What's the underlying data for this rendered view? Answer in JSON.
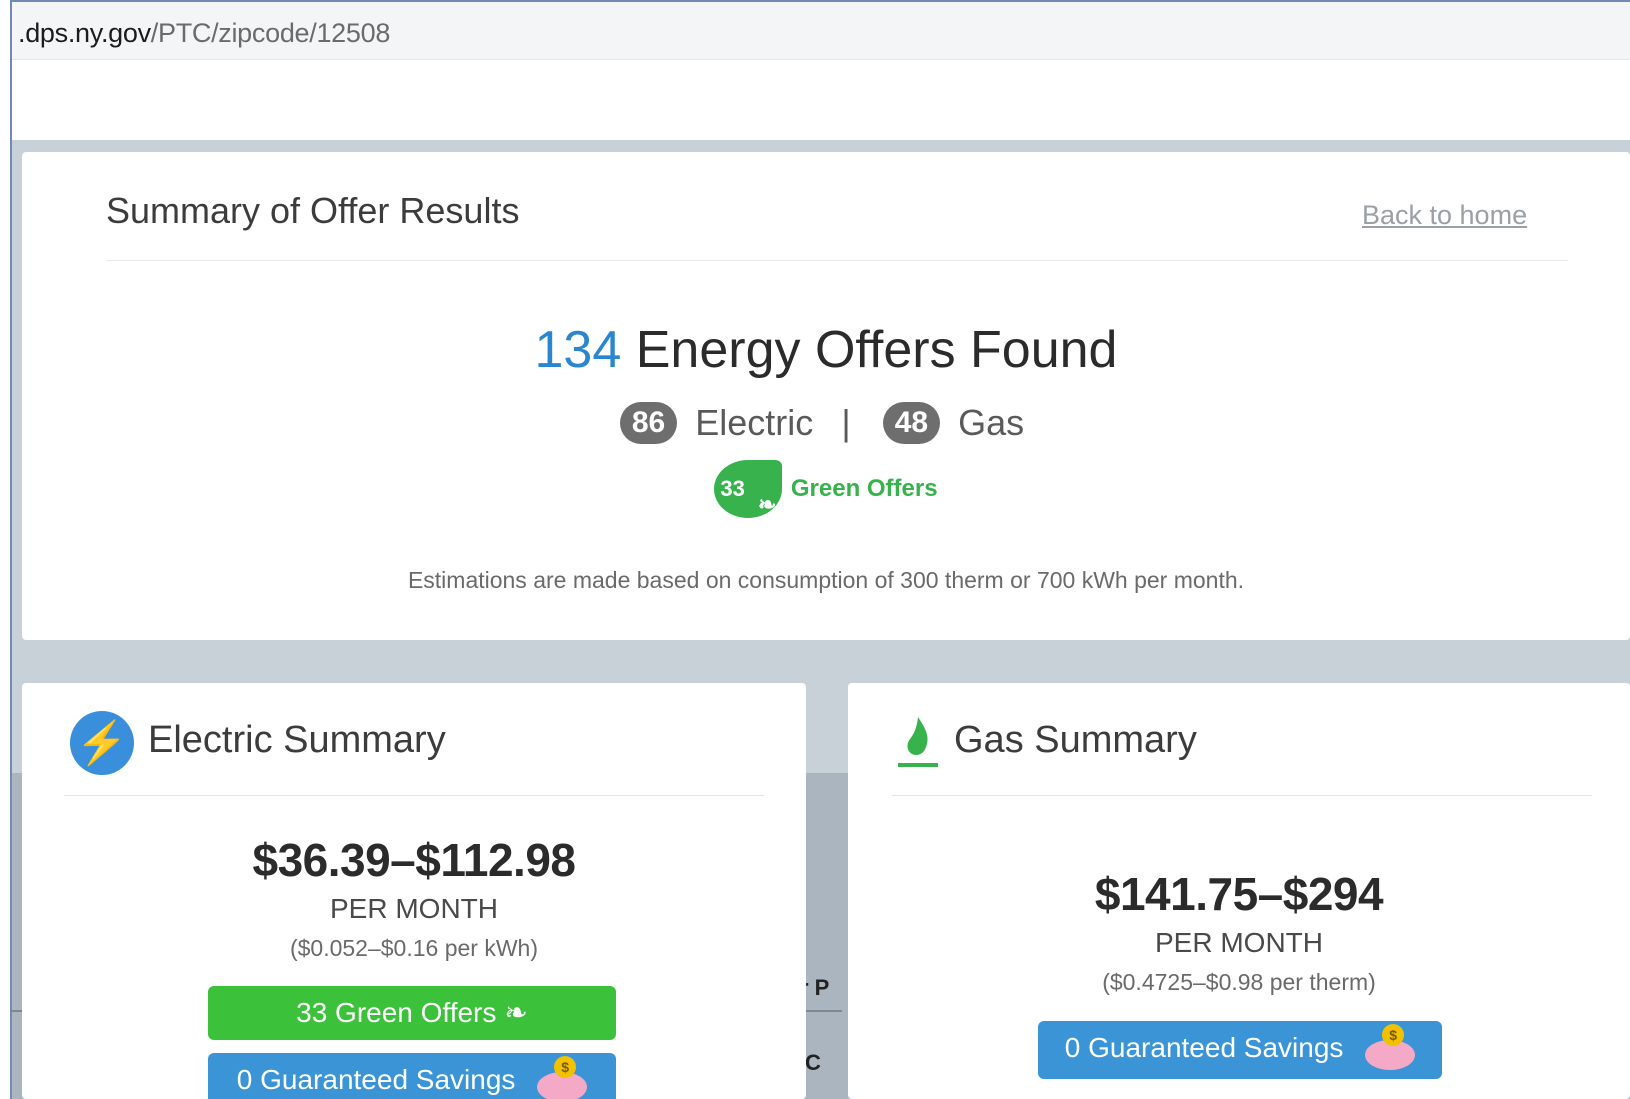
{
  "browser": {
    "url_host": ".dps.ny.gov",
    "url_path": "/PTC/zipcode/12508"
  },
  "summary": {
    "title": "Summary of Offer Results",
    "back_link": "Back to home",
    "offer_count": "134",
    "offers_found_label": "Energy Offers Found",
    "electric_count": "86",
    "electric_label": "Electric",
    "separator": "|",
    "gas_count": "48",
    "gas_label": "Gas",
    "green_count": "33",
    "green_label": "Green Offers",
    "estimation_note": "Estimations are made based on consumption of 300 therm or 700 kWh per month."
  },
  "electric": {
    "title": "Electric Summary",
    "price_range": "$36.39–$112.98",
    "per_month": "PER MONTH",
    "rate": "($0.052–$0.16 per kWh)",
    "green_button": "33 Green Offers",
    "savings_button": "0 Guaranteed Savings"
  },
  "gas": {
    "title": "Gas Summary",
    "price_range": "$141.75–$294",
    "per_month": "PER MONTH",
    "rate": "($0.4725–$0.98 per therm)",
    "savings_button": "0 Guaranteed Savings"
  },
  "background_fragments": {
    "fragment_1": "r P",
    "fragment_2": "C"
  },
  "colors": {
    "accent_blue": "#2a86d0",
    "green": "#3cc13b",
    "button_blue": "#3b94d6"
  }
}
